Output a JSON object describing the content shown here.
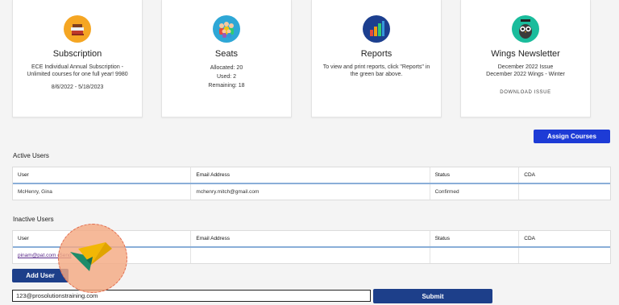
{
  "cards": [
    {
      "title": "Subscription",
      "icon": "books-icon",
      "lines": [
        "ECE Individual Annual Subscription -",
        "Unlimited courses for one full year! 9980"
      ],
      "extra": "8/6/2022 - 5/18/2023"
    },
    {
      "title": "Seats",
      "icon": "people-icon",
      "lines": [
        "Allocated: 20",
        "Used: 2",
        "Remaining: 18"
      ]
    },
    {
      "title": "Reports",
      "icon": "bar-chart-icon",
      "lines": [
        "To view and print reports, click \"Reports\" in",
        "the green bar above."
      ]
    },
    {
      "title": "Wings Newsletter",
      "icon": "owl-icon",
      "lines": [
        "December 2022 Issue",
        "December 2022 Wings - Winter"
      ],
      "link": "DOWNLOAD ISSUE"
    }
  ],
  "assign_courses_label": "Assign Courses",
  "active_users": {
    "label": "Active Users",
    "headers": [
      "User",
      "Email Address",
      "Status",
      "CDA"
    ],
    "rows": [
      [
        "McHenry, Gina",
        "mchenry.mitch@gmail.com",
        "Confirmed",
        ""
      ]
    ]
  },
  "inactive_users": {
    "label": "Inactive Users",
    "headers": [
      "User",
      "Email Address",
      "Status",
      "CDA"
    ],
    "rows": [
      [
        "pinam@pat.com (Send",
        "",
        "",
        ""
      ]
    ]
  },
  "add_user_label": "Add User",
  "email_input_value": "123@prosolutionstraining.com",
  "submit_label": "Submit",
  "colors": {
    "primary_button": "#1d3bd6",
    "header_rule": "#8aaed8",
    "overlay": "#f4aa82"
  }
}
